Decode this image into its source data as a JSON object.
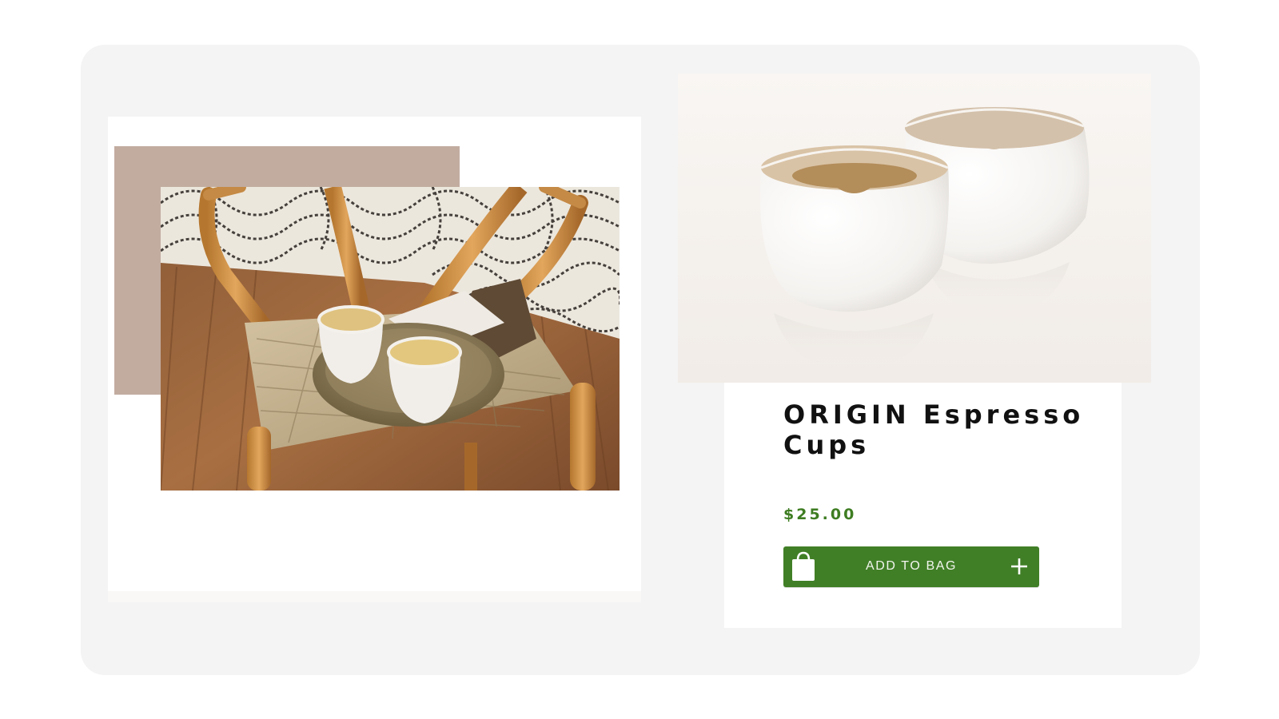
{
  "product": {
    "title": "ORIGIN Espresso Cups",
    "price": "$25.00",
    "add_to_bag_label": "ADD TO BAG"
  },
  "images": {
    "lifestyle": "lifestyle-photo: two espresso cups on a tray on a woven wooden chair",
    "product": "product-photo: two white ORIGIN espresso cups"
  },
  "icons": {
    "bag": "shopping-bag-icon",
    "plus": "plus-icon"
  },
  "colors": {
    "accent": "#417f27",
    "price": "#3e7d22",
    "taupe": "#c2aca0",
    "card_background": "#f4f4f4"
  }
}
